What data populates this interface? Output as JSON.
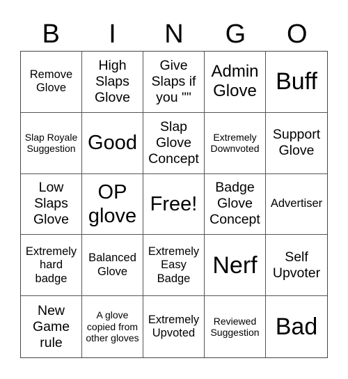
{
  "header": {
    "letters": [
      "B",
      "I",
      "N",
      "G",
      "O"
    ]
  },
  "cells": [
    "Remove Glove",
    "High Slaps Glove",
    "Give Slaps if you \"\"",
    "Admin Glove",
    "Buff",
    "Slap Royale Suggestion",
    "Good",
    "Slap Glove Concept",
    "Extremely Downvoted",
    "Support Glove",
    "Low Slaps Glove",
    "OP glove",
    "Free!",
    "Badge Glove Concept",
    "Advertiser",
    "Extremely hard badge",
    "Balanced Glove",
    "Extremely Easy Badge",
    "Nerf",
    "Self Upvoter",
    "New Game rule",
    "A glove copied from other gloves",
    "Extremely Upvoted",
    "Reviewed Suggestion",
    "Bad"
  ]
}
